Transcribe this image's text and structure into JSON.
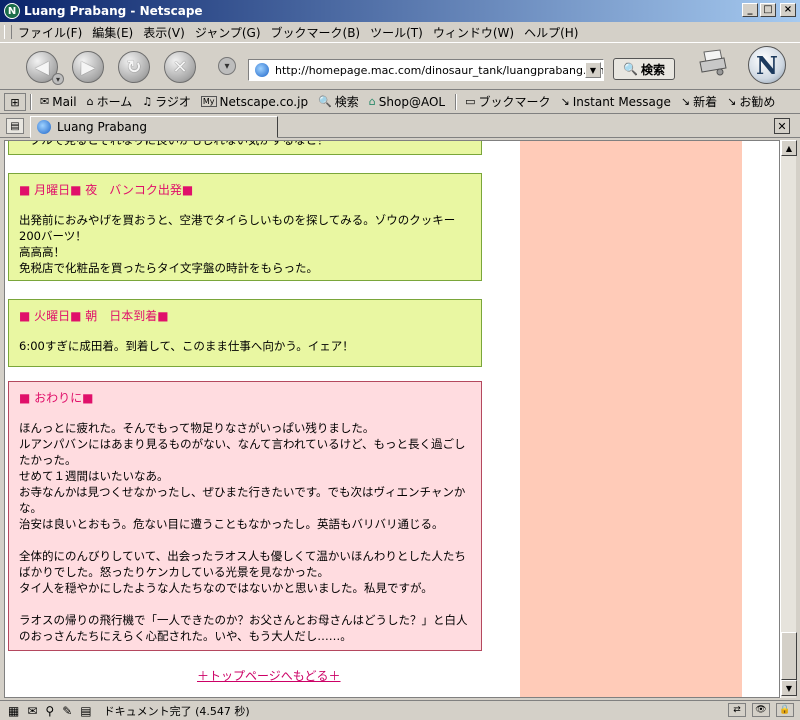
{
  "window": {
    "title": "Luang Prabang - Netscape"
  },
  "menu": [
    "ファイル(F)",
    "編集(E)",
    "表示(V)",
    "ジャンプ(G)",
    "ブックマーク(B)",
    "ツール(T)",
    "ウィンドウ(W)",
    "ヘルプ(H)"
  ],
  "navbar": {
    "url": "http://homepage.mac.com/dinosaur_tank/luangprabang.html",
    "search_label": "検索"
  },
  "personal_toolbar": {
    "items": [
      "Mail",
      "ホーム",
      "ラジオ",
      "Netscape.co.jp",
      "検索",
      "Shop@AOL",
      "ブックマーク",
      "Instant Message",
      "新着",
      "お勧め"
    ]
  },
  "tab": {
    "title": "Luang Prabang"
  },
  "content": {
    "partial_line": "ーブルで見るとそれなりに良いかもしれない気がするなと！",
    "sections": [
      {
        "heading": "■ 月曜日■ 夜　バンコク出発■",
        "body": "出発前におみやげを買おうと、空港でタイらしいものを探してみる。ゾウのクッキー200バーツ！\n高高高！\n免税店で化粧品を買ったらタイ文字盤の時計をもらった。"
      },
      {
        "heading": "■ 火曜日■ 朝　日本到着■",
        "body": "6:00すぎに成田着。到着して、このまま仕事へ向かう。イェア！"
      },
      {
        "heading": "■ おわりに■",
        "body": "ほんっとに疲れた。そんでもって物足りなさがいっぱい残りました。\nルアンパバンにはあまり見るものがない、なんて言われているけど、もっと長く過ごしたかった。\nせめて１週間はいたいなあ。\nお寺なんかは見つくせなかったし、ぜひまた行きたいです。でも次はヴィエンチャンかな。\n治安は良いとおもう。危ない目に遭うこともなかったし。英語もバリバリ通じる。\n\n全体的にのんびりしていて、出会ったラオス人も優しくて温かいほんわりとした人たちばかりでした。怒ったりケンカしている光景を見なかった。\nタイ人を穏やかにしたような人たちなのではないかと思いました。私見ですが。\n\nラオスの帰りの飛行機で「一人できたのか？お父さんとお母さんはどうした？」と白人のおっさんたちにえらく心配された。いや、もう大人だし……。"
      }
    ],
    "top_link": "＋トップページへもどる＋"
  },
  "status": {
    "text": "ドキュメント完了 (4.547 秒)"
  }
}
